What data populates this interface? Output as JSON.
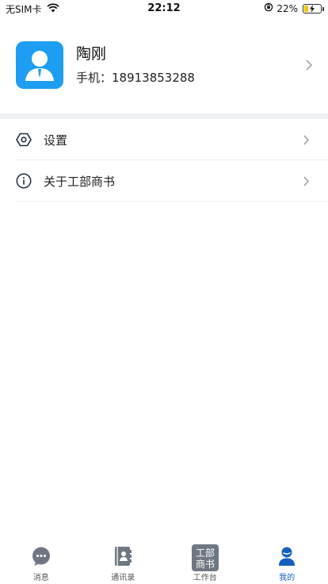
{
  "status": {
    "carrier": "无SIM卡",
    "time": "22:12",
    "battery_percent": "22%",
    "battery_level": 0.22,
    "icons": [
      "wifi-icon",
      "orientation-lock-icon",
      "battery-charging-icon"
    ]
  },
  "profile": {
    "name": "陶刚",
    "phone": "手机：18913853288",
    "avatar_icon": "person-avatar-icon",
    "accent": "#1e9ef2"
  },
  "menu": [
    {
      "label": "设置",
      "icon": "settings-hexagon-icon"
    },
    {
      "label": "关于工部商书",
      "icon": "info-circle-icon"
    }
  ],
  "tabs": [
    {
      "label": "消息",
      "icon": "message-bubble-icon",
      "active": false
    },
    {
      "label": "通讯录",
      "icon": "contacts-book-icon",
      "active": false
    },
    {
      "label": "工作台",
      "icon": "workbench-logo-icon",
      "logo_text": "工部\n商书",
      "active": false
    },
    {
      "label": "我的",
      "icon": "user-profile-icon",
      "active": true
    }
  ],
  "colors": {
    "active_tab": "#1560bd",
    "inactive_tab": "#555555",
    "section_gap": "#eef0f4"
  }
}
